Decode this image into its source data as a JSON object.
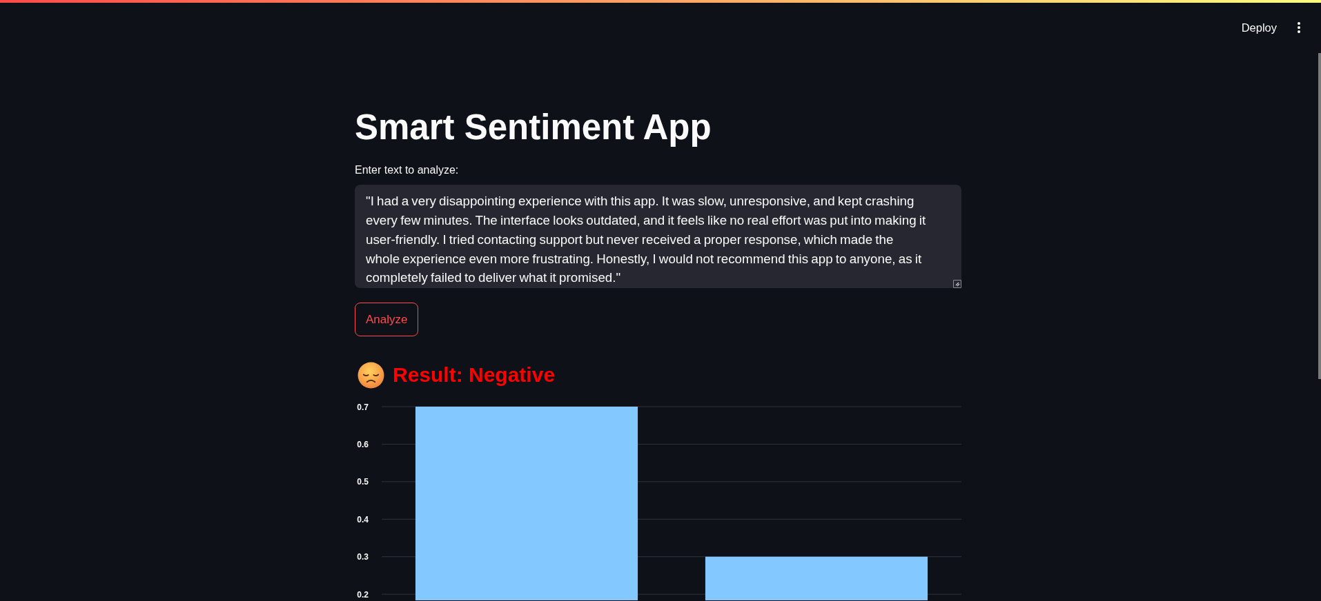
{
  "header": {
    "deploy_button": "Deploy"
  },
  "title": "Smart Sentiment App",
  "input": {
    "label": "Enter text to analyze:",
    "value": "\"I had a very disappointing experience with this app. It was slow, unresponsive, and kept crashing every few minutes. The interface looks outdated, and it feels like no real effort was put into making it user-friendly. I tried contacting support but never received a proper response, which made the whole experience even more frustrating. Honestly, I would not recommend this app to anyone, as it completely failed to deliver what it promised.\""
  },
  "analyze_button": "Analyze",
  "result": {
    "text": "Result: Negative"
  },
  "chart": {
    "chart_data": {
      "type": "bar",
      "values": [
        0.7,
        0.3
      ],
      "ylim": [
        0,
        0.7
      ],
      "yticks": [
        0.2,
        0.3,
        0.4,
        0.5,
        0.6,
        0.7
      ],
      "grid": true
    }
  }
}
